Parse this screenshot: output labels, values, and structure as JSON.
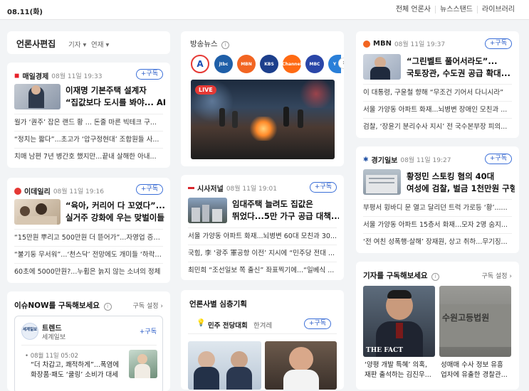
{
  "topbar": {
    "date": "08.11(화)",
    "links": [
      "전체 언론사",
      "뉴스스탠드",
      "라이브러리"
    ]
  },
  "pressEdit": {
    "title": "언론사편집",
    "filter1": "기자",
    "filter2": "연재"
  },
  "cards": {
    "maeil": {
      "press": "매일경제",
      "date": "08월 11일 19:33",
      "subscribe": "+구독",
      "headline1": "이재명 기본주택 설계자",
      "headline2": "“집값보다 도시를 봐야... AI...",
      "items": [
        "월가 ‘퀀주’ 잡은 랜드 황 ... 돈줄 마른 빅테크 구...",
        "“정치는 짧다”...초고가 ‘압구정현대’ 조합원들 사...",
        "치매 남편 7년 병간호 했지만...끝내 살해한 아내..."
      ]
    },
    "edaily": {
      "press": "이데일리",
      "date": "08월 11일 19:16",
      "subscribe": "+구독",
      "headline1": "“육아, 커리어 다 꼬였다”...",
      "headline2": "실거주 강화에 우는 맞벌이들",
      "items": [
        "“15만원 뿌리고 500만원 더 뜯어가”...자영업 증세?",
        "“불기둥 무서워”...‘천스닥’ 전망에도 개미들 ‘하락 ...",
        "60초에 5000만원?...누휩은 늙지 않는 소녀의 정체"
      ]
    },
    "issue": {
      "title": "이슈NOW를 구독해보세요",
      "setting": "구독 설정",
      "trend_name": "트렌드",
      "trend_press": "세계일보",
      "trend_logo": "세계일보",
      "subscribe": "+구독",
      "date": "08월 11일 05:02",
      "headline1": "“더 차갑고, 쾌적하게”...폭염에",
      "headline2": "화장품·패도 ‘쿨링’ 소비가 대세"
    },
    "broadcast": {
      "title": "방송뉴스",
      "channels": [
        "A",
        "jtbc",
        "MBN",
        "KBS",
        "Channel",
        "MBC",
        "Y"
      ],
      "live": "LIVE"
    },
    "sisa": {
      "press": "시사저널",
      "date": "08월 11일 19:01",
      "subscribe": "+구독",
      "headline1": "임대주택 늘려도 집값은",
      "headline2": "뛰었다...5만 가구 공급 대책...",
      "items": [
        "서울 가양동 아파트 화재...뇌병변 60대 모친과 30...",
        "국힘, 李 ‘광주 軍공항 이전’ 지시에 “민주당 전대 ...",
        "최민희 “조선일보 쪽 출신” 좌표찍기에...“일베식 ..."
      ]
    },
    "planning": {
      "title": "언론사별 심층기획",
      "item_title": "민주 전당대회",
      "item_press": "한겨레",
      "subscribe": "+구독"
    },
    "mbn": {
      "press": "MBN",
      "date": "08월 11일 19:37",
      "subscribe": "+구독",
      "headline1": "“그린벨트 풀어서라도”...",
      "headline2": "국토장관, 수도권 공급 확대...",
      "items": [
        "이 대통령, 구윤철 향해 “무조건 기어서 다니시라”",
        "서울 가양동 아파트 화재...뇌병변 장애인 모친과 ...",
        "검찰, ‘장윤기 분리수사 지시’ 전 국수본부장 피의..."
      ]
    },
    "kyeonggi": {
      "press": "경기일보",
      "date": "08월 11일 19:27",
      "subscribe": "+구독",
      "headline1": "황정민 스토킹 혐의 40대",
      "headline2": "여성에 검찰, 벌금 1천만원 구형",
      "items": [
        "부평서 윙바디 문 열고 달리던 트럭 가로등 ‘황’......",
        "서울 가양동 아파트 15층서 화재...모자 2명 숨지...",
        "‘전 여친 성폭행·살해’ 장재원, 상고 취하...무기징..."
      ]
    },
    "reporter": {
      "title": "기자를 구독해보세요",
      "setting": "구독 설정",
      "caption1a": "‘양평 개발 특혜’ 의혹,",
      "caption1b": "재판 출석하는 김진우...",
      "caption2a": "성매매 수사 정보 유흥",
      "caption2b": "업자에 유출한 경찰관...",
      "photo_text": "THE FACT",
      "court_text": "수원고등법원"
    }
  },
  "colors": {
    "accent": "#2b5dc8",
    "live": "#e53935",
    "maeil": "#e6212a",
    "edaily": "#e53935",
    "mbn": "#f26522",
    "sisa": "#d8262d",
    "kyeonggi": "#1e4fa3"
  }
}
